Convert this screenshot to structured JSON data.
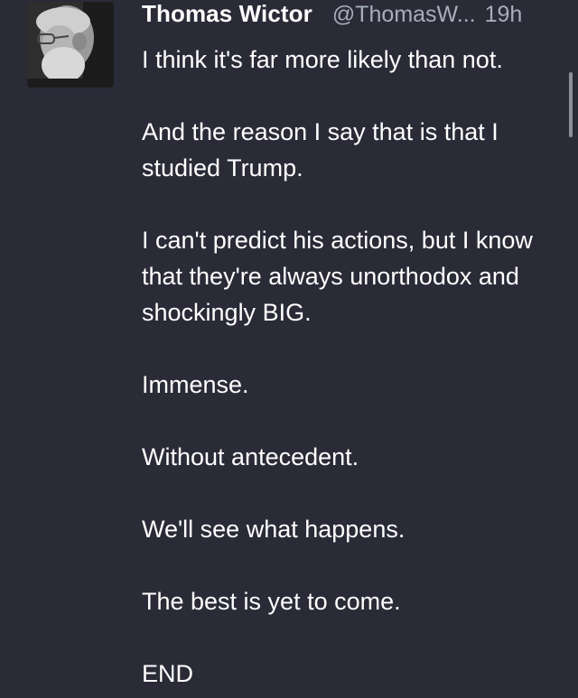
{
  "tweet": {
    "display_name": "Thomas Wictor",
    "handle": "@ThomasW...",
    "time": "19h",
    "paragraphs": [
      "I think it's far more likely than not.",
      "And the reason I say that is that I studied Trump.",
      "I can't predict his actions, but I know that they're always unorthodox and shockingly BIG.",
      "Immense.",
      "Without antecedent.",
      "We'll see what happens.",
      "The best is yet to come.",
      "END"
    ]
  }
}
